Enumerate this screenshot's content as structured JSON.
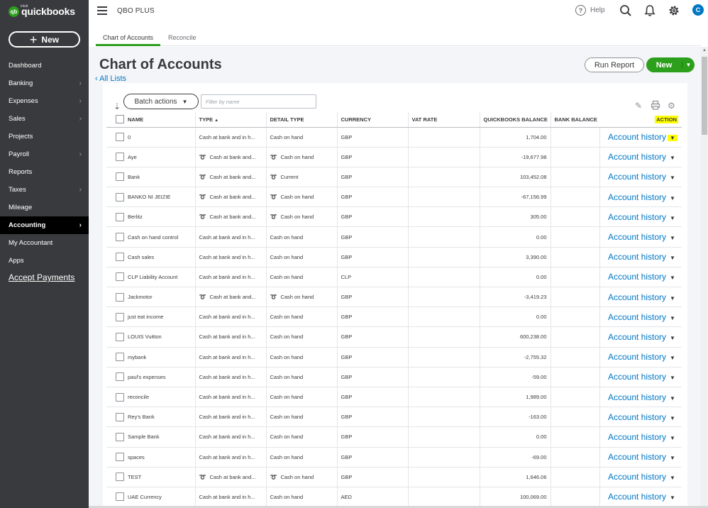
{
  "app": {
    "logo_text": "quickbooks",
    "logo_brand": "intuit",
    "company_name": "QBO PLUS",
    "help_label": "Help",
    "avatar_initial": "C",
    "colors": {
      "brand_green": "#2ca01c",
      "link_blue": "#0077c5",
      "sidebar_bg": "#393a3d",
      "highlight": "#ffff00"
    }
  },
  "sidebar": {
    "new_label": "New",
    "items": [
      {
        "label": "Dashboard",
        "chevron": false
      },
      {
        "label": "Banking",
        "chevron": true
      },
      {
        "label": "Expenses",
        "chevron": true
      },
      {
        "label": "Sales",
        "chevron": true
      },
      {
        "label": "Projects",
        "chevron": false
      },
      {
        "label": "Payroll",
        "chevron": true
      },
      {
        "label": "Reports",
        "chevron": false
      },
      {
        "label": "Taxes",
        "chevron": true
      },
      {
        "label": "Mileage",
        "chevron": false
      },
      {
        "label": "Accounting",
        "chevron": true,
        "active": true
      },
      {
        "label": "My Accountant",
        "chevron": false
      },
      {
        "label": "Apps",
        "chevron": false
      }
    ],
    "accept_payments": "Accept Payments"
  },
  "tabs": [
    {
      "label": "Chart of Accounts",
      "active": true
    },
    {
      "label": "Reconcile",
      "active": false
    }
  ],
  "page": {
    "title": "Chart of Accounts",
    "all_lists": "All Lists",
    "run_report": "Run Report",
    "new_label": "New"
  },
  "toolbar": {
    "batch_actions": "Batch actions",
    "filter_placeholder": "Filter by name"
  },
  "table": {
    "columns": [
      "NAME",
      "TYPE",
      "DETAIL TYPE",
      "CURRENCY",
      "VAT RATE",
      "QUICKBOOKS BALANCE",
      "BANK BALANCE",
      "ACTION"
    ],
    "action_label": "Account history",
    "rows": [
      {
        "name": "0",
        "type": "Cash at bank and in h...",
        "detail": "Cash on hand",
        "currency": "GBP",
        "vat": "",
        "qb_balance": "1,704.00",
        "bank_balance": "",
        "linked": false
      },
      {
        "name": "Aye",
        "type": "Cash at bank and...",
        "detail": "Cash on hand",
        "currency": "GBP",
        "vat": "",
        "qb_balance": "-19,677.98",
        "bank_balance": "",
        "linked": true
      },
      {
        "name": "Bank",
        "type": "Cash at bank and...",
        "detail": "Current",
        "currency": "GBP",
        "vat": "",
        "qb_balance": "103,452.08",
        "bank_balance": "",
        "linked": true
      },
      {
        "name": "BANKO NI JEIZIE",
        "type": "Cash at bank and...",
        "detail": "Cash on hand",
        "currency": "GBP",
        "vat": "",
        "qb_balance": "-67,156.99",
        "bank_balance": "",
        "linked": true
      },
      {
        "name": "Berlitz",
        "type": "Cash at bank and...",
        "detail": "Cash on hand",
        "currency": "GBP",
        "vat": "",
        "qb_balance": "305.00",
        "bank_balance": "",
        "linked": true
      },
      {
        "name": "Cash on hand control",
        "type": "Cash at bank and in h...",
        "detail": "Cash on hand",
        "currency": "GBP",
        "vat": "",
        "qb_balance": "0.00",
        "bank_balance": "",
        "linked": false
      },
      {
        "name": "Cash sales",
        "type": "Cash at bank and in h...",
        "detail": "Cash on hand",
        "currency": "GBP",
        "vat": "",
        "qb_balance": "3,390.00",
        "bank_balance": "",
        "linked": false
      },
      {
        "name": "CLP Liability Account",
        "type": "Cash at bank and in h...",
        "detail": "Cash on hand",
        "currency": "CLP",
        "vat": "",
        "qb_balance": "0.00",
        "bank_balance": "",
        "linked": false
      },
      {
        "name": "Jackmotor",
        "type": "Cash at bank and...",
        "detail": "Cash on hand",
        "currency": "GBP",
        "vat": "",
        "qb_balance": "-3,419.23",
        "bank_balance": "",
        "linked": true
      },
      {
        "name": "just eat income",
        "type": "Cash at bank and in h...",
        "detail": "Cash on hand",
        "currency": "GBP",
        "vat": "",
        "qb_balance": "0.00",
        "bank_balance": "",
        "linked": false
      },
      {
        "name": "LOUIS Vuitton",
        "type": "Cash at bank and in h...",
        "detail": "Cash on hand",
        "currency": "GBP",
        "vat": "",
        "qb_balance": "600,238.00",
        "bank_balance": "",
        "linked": false
      },
      {
        "name": "mybank",
        "type": "Cash at bank and in h...",
        "detail": "Cash on hand",
        "currency": "GBP",
        "vat": "",
        "qb_balance": "-2,755.32",
        "bank_balance": "",
        "linked": false
      },
      {
        "name": "paul's expenses",
        "type": "Cash at bank and in h...",
        "detail": "Cash on hand",
        "currency": "GBP",
        "vat": "",
        "qb_balance": "-59.00",
        "bank_balance": "",
        "linked": false
      },
      {
        "name": "reconcile",
        "type": "Cash at bank and in h...",
        "detail": "Cash on hand",
        "currency": "GBP",
        "vat": "",
        "qb_balance": "1,989.00",
        "bank_balance": "",
        "linked": false
      },
      {
        "name": "Rey's Bank",
        "type": "Cash at bank and in h...",
        "detail": "Cash on hand",
        "currency": "GBP",
        "vat": "",
        "qb_balance": "-163.00",
        "bank_balance": "",
        "linked": false
      },
      {
        "name": "Sample Bank",
        "type": "Cash at bank and in h...",
        "detail": "Cash on hand",
        "currency": "GBP",
        "vat": "",
        "qb_balance": "0.00",
        "bank_balance": "",
        "linked": false
      },
      {
        "name": "spaces",
        "type": "Cash at bank and in h...",
        "detail": "Cash on hand",
        "currency": "GBP",
        "vat": "",
        "qb_balance": "-69.00",
        "bank_balance": "",
        "linked": false
      },
      {
        "name": "TEST",
        "type": "Cash at bank and...",
        "detail": "Cash on hand",
        "currency": "GBP",
        "vat": "",
        "qb_balance": "1,646.06",
        "bank_balance": "",
        "linked": true
      },
      {
        "name": "UAE Currency",
        "type": "Cash at bank and in h...",
        "detail": "Cash on hand",
        "currency": "AED",
        "vat": "",
        "qb_balance": "100,069.00",
        "bank_balance": "",
        "linked": false
      }
    ]
  }
}
